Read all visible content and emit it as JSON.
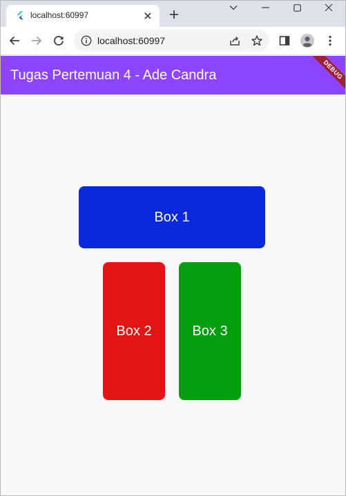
{
  "browser": {
    "tab": {
      "title": "localhost:60997",
      "favicon": "flutter-logo-icon"
    },
    "url": "localhost:60997"
  },
  "app": {
    "title": "Tugas Pertemuan 4 - Ade Candra",
    "debug_banner": "DEBUG",
    "appbar_color": "#8e45ff"
  },
  "boxes": [
    {
      "label": "Box 1",
      "color": "#0a28dc"
    },
    {
      "label": "Box 2",
      "color": "#e21414"
    },
    {
      "label": "Box 3",
      "color": "#049e0f"
    }
  ]
}
